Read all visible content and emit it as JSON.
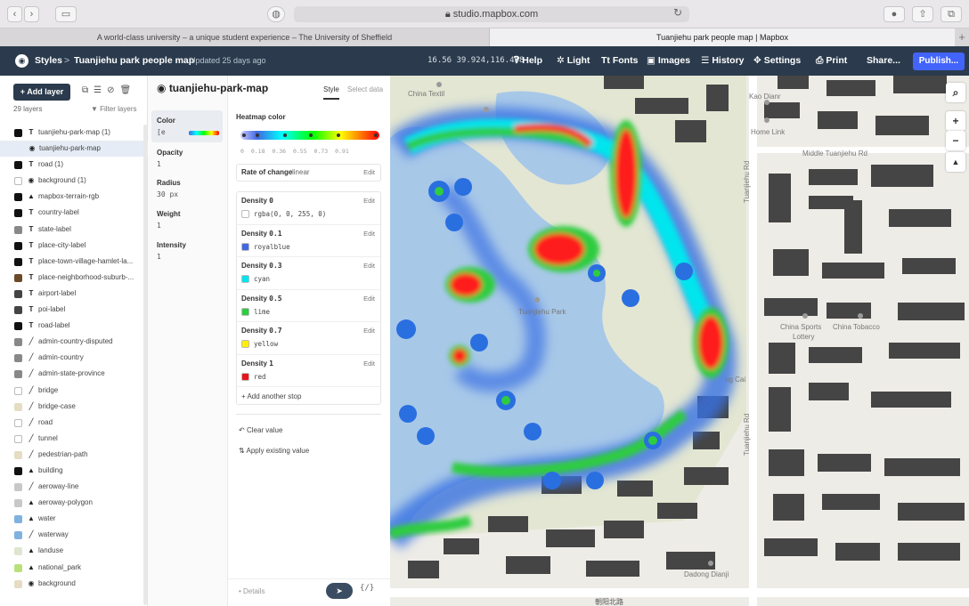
{
  "browser": {
    "url": "studio.mapbox.com",
    "tabs": [
      "A world-class university – a unique student experience – The University of Sheffield",
      "Tuanjiehu park people map | Mapbox"
    ]
  },
  "toolbar": {
    "styles": "Styles",
    "separator": ">",
    "map_name": "Tuanjiehu park people map",
    "updated": "Updated 25 days ago",
    "coords": "16.56 39.924,116.468",
    "help": "Help",
    "light": "Light",
    "fonts": "Fonts",
    "images": "Images",
    "history": "History",
    "settings": "Settings",
    "print": "Print",
    "share": "Share...",
    "publish": "Publish..."
  },
  "layers_panel": {
    "add_layer": "+ Add layer",
    "count": "29 layers",
    "filter": "Filter layers",
    "layers": [
      {
        "name": "tuanjiehu-park-map (1)",
        "type": "T",
        "color": "#111111",
        "selected": false,
        "child": false
      },
      {
        "name": "tuanjiehu-park-map",
        "type": "◉",
        "color": "none",
        "selected": true,
        "child": true
      },
      {
        "name": "road (1)",
        "type": "T",
        "color": "#111111",
        "selected": false,
        "child": false
      },
      {
        "name": "background (1)",
        "type": "◉",
        "color": "#ffffff",
        "selected": false,
        "child": false
      },
      {
        "name": "mapbox-terrain-rgb",
        "type": "▲",
        "color": "#111111",
        "selected": false,
        "child": false
      },
      {
        "name": "country-label",
        "type": "T",
        "color": "#111111",
        "selected": false,
        "child": false
      },
      {
        "name": "state-label",
        "type": "T",
        "color": "#888888",
        "selected": false,
        "child": false
      },
      {
        "name": "place-city-label",
        "type": "T",
        "color": "#111111",
        "selected": false,
        "child": false
      },
      {
        "name": "place-town-village-hamlet-la...",
        "type": "T",
        "color": "#111111",
        "selected": false,
        "child": false
      },
      {
        "name": "place-neighborhood-suburb-...",
        "type": "T",
        "color": "#6b4a2a",
        "selected": false,
        "child": false
      },
      {
        "name": "airport-label",
        "type": "T",
        "color": "#444444",
        "selected": false,
        "child": false
      },
      {
        "name": "poi-label",
        "type": "T",
        "color": "#444444",
        "selected": false,
        "child": false
      },
      {
        "name": "road-label",
        "type": "T",
        "color": "#111111",
        "selected": false,
        "child": false
      },
      {
        "name": "admin-country-disputed",
        "type": "╱",
        "color": "#888888",
        "selected": false,
        "child": false
      },
      {
        "name": "admin-country",
        "type": "╱",
        "color": "#888888",
        "selected": false,
        "child": false
      },
      {
        "name": "admin-state-province",
        "type": "╱",
        "color": "#888888",
        "selected": false,
        "child": false
      },
      {
        "name": "bridge",
        "type": "╱",
        "color": "#ffffff",
        "selected": false,
        "child": false
      },
      {
        "name": "bridge-case",
        "type": "╱",
        "color": "#e6dcc4",
        "selected": false,
        "child": false
      },
      {
        "name": "road",
        "type": "╱",
        "color": "#ffffff",
        "selected": false,
        "child": false
      },
      {
        "name": "tunnel",
        "type": "╱",
        "color": "#ffffff",
        "selected": false,
        "child": false
      },
      {
        "name": "pedestrian-path",
        "type": "╱",
        "color": "#e6dcc4",
        "selected": false,
        "child": false
      },
      {
        "name": "building",
        "type": "▲",
        "color": "#111111",
        "selected": false,
        "child": false
      },
      {
        "name": "aeroway-line",
        "type": "╱",
        "color": "#c8c8c8",
        "selected": false,
        "child": false
      },
      {
        "name": "aeroway-polygon",
        "type": "▲",
        "color": "#c8c8c8",
        "selected": false,
        "child": false
      },
      {
        "name": "water",
        "type": "▲",
        "color": "#7fb2df",
        "selected": false,
        "child": false
      },
      {
        "name": "waterway",
        "type": "╱",
        "color": "#7fb2df",
        "selected": false,
        "child": false
      },
      {
        "name": "landuse",
        "type": "▲",
        "color": "#dfe6cf",
        "selected": false,
        "child": false
      },
      {
        "name": "national_park",
        "type": "▲",
        "color": "#b9e07a",
        "selected": false,
        "child": false
      },
      {
        "name": "background",
        "type": "◉",
        "color": "#e6dcc4",
        "selected": false,
        "child": false
      }
    ]
  },
  "layer_editor": {
    "title": "tuanjiehu-park-map",
    "tab_style": "Style",
    "tab_select_data": "Select data",
    "nav": {
      "color_label": "Color",
      "color_value": "[e",
      "opacity_label": "Opacity",
      "opacity_value": "1",
      "radius_label": "Radius",
      "radius_value": "30 px",
      "weight_label": "Weight",
      "weight_value": "1",
      "intensity_label": "Intensity",
      "intensity_value": "1"
    },
    "heatmap_color_label": "Heatmap color",
    "ramp_ticks": "0   0.18  0.36  0.55  0.73  0.91",
    "rate_label": "Rate of change",
    "rate_value": "linear",
    "edit": "Edit",
    "stops": [
      {
        "label": "Density",
        "density": "0",
        "value": "rgba(0, 0, 255, 0)",
        "color": "rgba(0,0,255,0)"
      },
      {
        "label": "Density",
        "density": "0.1",
        "value": "royalblue",
        "color": "#4169e1"
      },
      {
        "label": "Density",
        "density": "0.3",
        "value": "cyan",
        "color": "#00e5ee"
      },
      {
        "label": "Density",
        "density": "0.5",
        "value": "lime",
        "color": "#2ecc40"
      },
      {
        "label": "Density",
        "density": "0.7",
        "value": "yellow",
        "color": "#ffee00"
      },
      {
        "label": "Density",
        "density": "1",
        "value": "red",
        "color": "#e8141b"
      }
    ],
    "add_stop": "+ Add another stop",
    "clear_value": "Clear value",
    "apply_existing": "Apply existing value",
    "details": "• Details",
    "code": "{/}"
  },
  "map": {
    "labels": {
      "middle_road": "Middle Tuanjiehu Rd",
      "tuanjiehu_rd_top": "Tuanjiehu Rd",
      "tuanjiehu_rd_bottom": "Tuanjiehu Rd",
      "home_link": "Home Link",
      "kao_dianr": "Kao Dianr",
      "china_text": "China Textil",
      "park": "Tuanjiehu Park",
      "china_sports": "China Sports",
      "lottery": "Lottery",
      "china_tobacco": "China Tobacco",
      "cai": "ng Cai",
      "dianji": "Dadong Dianji",
      "bottom_road": "朝阳北路"
    },
    "zoom_in": "+",
    "zoom_out": "−",
    "search": "⌕",
    "compass": "▲"
  }
}
